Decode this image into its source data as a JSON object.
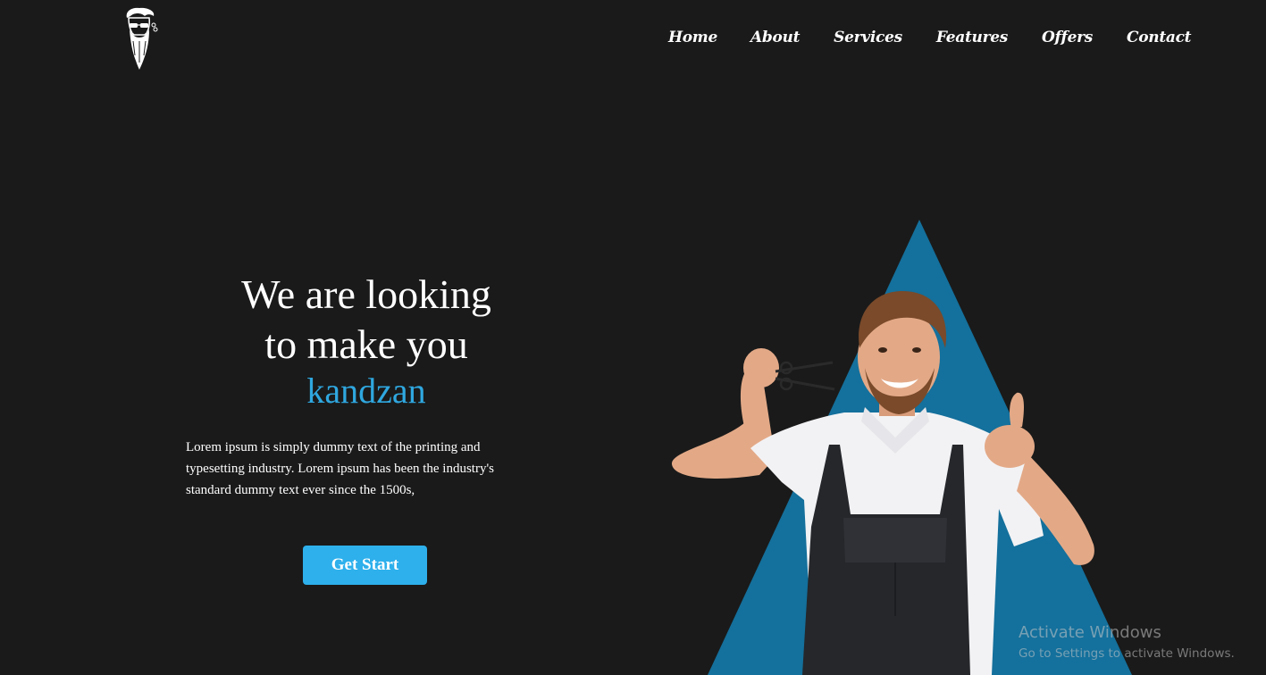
{
  "header": {
    "logo_icon": "bearded-barber-logo",
    "nav": [
      {
        "label": "Home"
      },
      {
        "label": "About"
      },
      {
        "label": "Services"
      },
      {
        "label": "Features"
      },
      {
        "label": "Offers"
      },
      {
        "label": "Contact"
      }
    ]
  },
  "hero": {
    "title_line1": "We are looking",
    "title_line2": "to make you",
    "accent": "kandzan",
    "description": "Lorem ipsum is simply dummy text of the printing and typesetting industry. Lorem ipsum has been the industry's standard dummy text ever since the 1500s,",
    "cta_label": "Get Start",
    "image_icon": "barber-holding-scissors-thumbs-up",
    "colors": {
      "background": "#1a1a1a",
      "accent_text": "#2fa7df",
      "button": "#2eb0ec",
      "triangle": "#14709c"
    }
  },
  "watermark": {
    "title": "Activate Windows",
    "subtitle": "Go to Settings to activate Windows."
  }
}
